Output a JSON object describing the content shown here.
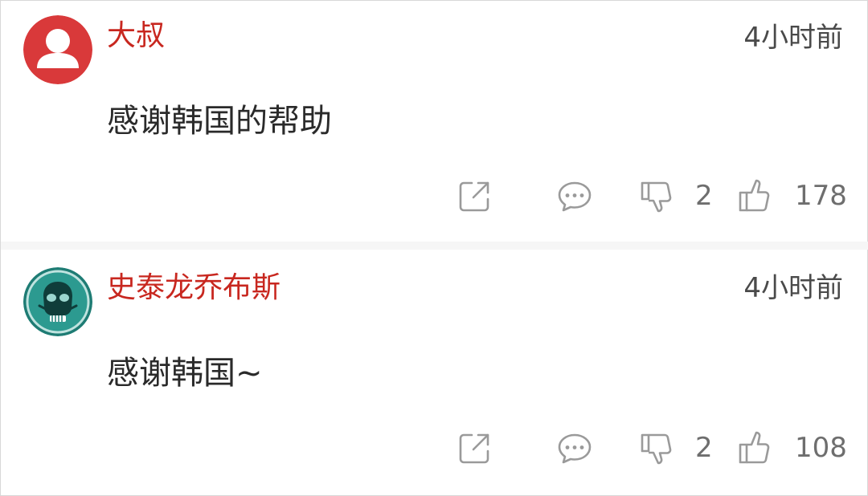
{
  "comments": [
    {
      "username": "大叔",
      "time": "4小时前",
      "text": "感谢韩国的帮助",
      "dislike_count": "2",
      "like_count": "178",
      "avatar_icon": "default-user-avatar",
      "avatar_color": "#d9393a"
    },
    {
      "username": "史泰龙乔布斯",
      "time": "4小时前",
      "text": "感谢韩国~",
      "dislike_count": "2",
      "like_count": "108",
      "avatar_icon": "skull-mask-avatar",
      "avatar_color": "#1e7c74"
    }
  ],
  "icons": {
    "share": "share-icon",
    "reply": "comment-bubble-icon",
    "dislike": "thumbs-down-icon",
    "like": "thumbs-up-icon"
  },
  "colors": {
    "username": "#c8271f",
    "text": "#2a2a2a",
    "meta": "#6e6e6e"
  }
}
